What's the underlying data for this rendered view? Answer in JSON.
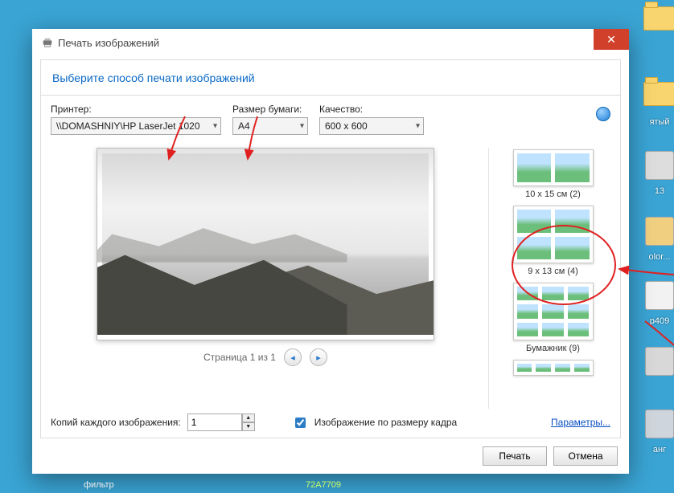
{
  "desktop": {
    "icons": [
      {
        "label": ""
      },
      {
        "label": "ятый"
      },
      {
        "label": ""
      },
      {
        "label": "13"
      },
      {
        "label": "olor..."
      },
      {
        "label": "p409"
      },
      {
        "label": ""
      },
      {
        "label": "анг"
      }
    ]
  },
  "dialog": {
    "title": "Печать изображений",
    "close_glyph": "✕",
    "header": "Выберите способ печати изображений",
    "printer_label": "Принтер:",
    "printer_value": "\\\\DOMASHNIY\\HP LaserJet 1020",
    "paper_label": "Размер бумаги:",
    "paper_value": "A4",
    "quality_label": "Качество:",
    "quality_value": "600 x 600",
    "pager": {
      "text": "Страница 1 из 1",
      "prev": "◂",
      "next": "▸"
    },
    "layouts": [
      {
        "label": "10 x 15 см (2)",
        "grid": "g2"
      },
      {
        "label": "9 x 13 см (4)",
        "grid": "g4",
        "circled": true
      },
      {
        "label": "Бумажник (9)",
        "grid": "g9"
      },
      {
        "label": "",
        "grid": "partial"
      }
    ],
    "copies_label": "Копий каждого изображения:",
    "copies_value": "1",
    "fit_label": "Изображение по размеру кадра",
    "fit_checked": true,
    "params_link": "Параметры...",
    "print_btn": "Печать",
    "cancel_btn": "Отмена",
    "help_tip": "?"
  },
  "status": {
    "left": "фильтр",
    "right": "72A7709"
  }
}
